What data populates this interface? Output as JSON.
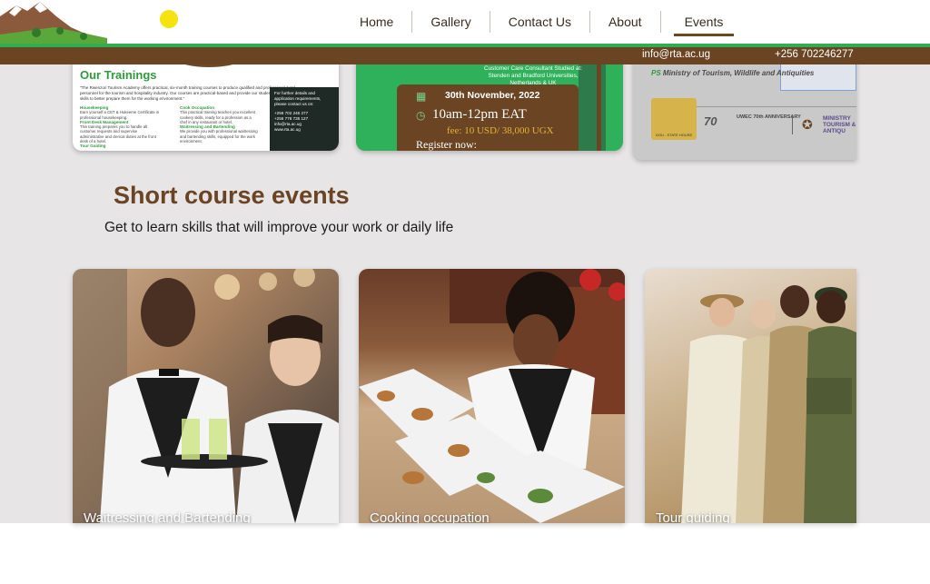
{
  "nav": {
    "items": [
      {
        "label": "Home"
      },
      {
        "label": "Gallery"
      },
      {
        "label": "Contact Us"
      },
      {
        "label": "About"
      },
      {
        "label": "Events",
        "active": true
      }
    ]
  },
  "contact": {
    "email": "info@rta.ac.ug",
    "phone": "+256 702246277"
  },
  "top_cards": {
    "trainings": {
      "title": "Our Trainings",
      "intro": "\"The Rwenzori Tourism Academy offers practical, six-month training courses to produce qualified and professional hotel personnel for the tourism and hospitality industry. Our courses are practical-based and provide our students with hands-on skills to better prepare them for the working environment.\"",
      "col1": [
        {
          "head": "Housekeeping",
          "text": "Earn yourself a CET & Hukeeme Certificate in professional housekeeping."
        },
        {
          "head": "Front Desk Management",
          "text": "This training prepares you to handle all customer requests and supervise administrative and clerical duties at the front desk of a hotel."
        },
        {
          "head": "Tour Guiding",
          "text": ""
        }
      ],
      "col2": [
        {
          "head": "Cook Occupation",
          "text": "This practical training teaches you excellent cookery skills, ready for a profession as a chef in any restaurant or hotel."
        },
        {
          "head": "Waitressing and Bartending",
          "text": "We provide you with professional waitressing and bartending skills, equipped for the work environment."
        }
      ],
      "panel_text": "For further details and application requirements, please contact us on:",
      "panel_phone1": "+256 702 246 277",
      "panel_phone2": "+256 778 735 127",
      "panel_email": "info@rta.ac.ug",
      "panel_web": "www.rta.ac.ug"
    },
    "event": {
      "heading": "Customer Care Consultant Studied at: Stenden and Bradford Universities, Netherlands & UK",
      "date": "30th November, 2022",
      "time": "10am-12pm EAT",
      "fee": "fee: 10 USD/ 38,000 UGX",
      "register": "Register now:"
    },
    "partners": {
      "ps_label": "PS",
      "ministry": "Ministry of Tourism, Wildlife and Antiquities",
      "logo1_caption": "GOU - STATE HOUSE",
      "logo2_text": "70",
      "uwec": "UWEC 70th ANNIVERSARY",
      "ministry2": "MINISTRY TOURISM & ANTIQU"
    }
  },
  "section": {
    "title": "Short course events",
    "subtitle": "Get to learn skills that will improve your work or daily life"
  },
  "courses": [
    {
      "caption": "Waitressing and Bartending"
    },
    {
      "caption": "Cooking occupation"
    },
    {
      "caption": "Tour guiding"
    }
  ],
  "colors": {
    "brand_brown": "#6b4423",
    "brand_green": "#2fae4d",
    "sun_yellow": "#f5e20f"
  }
}
